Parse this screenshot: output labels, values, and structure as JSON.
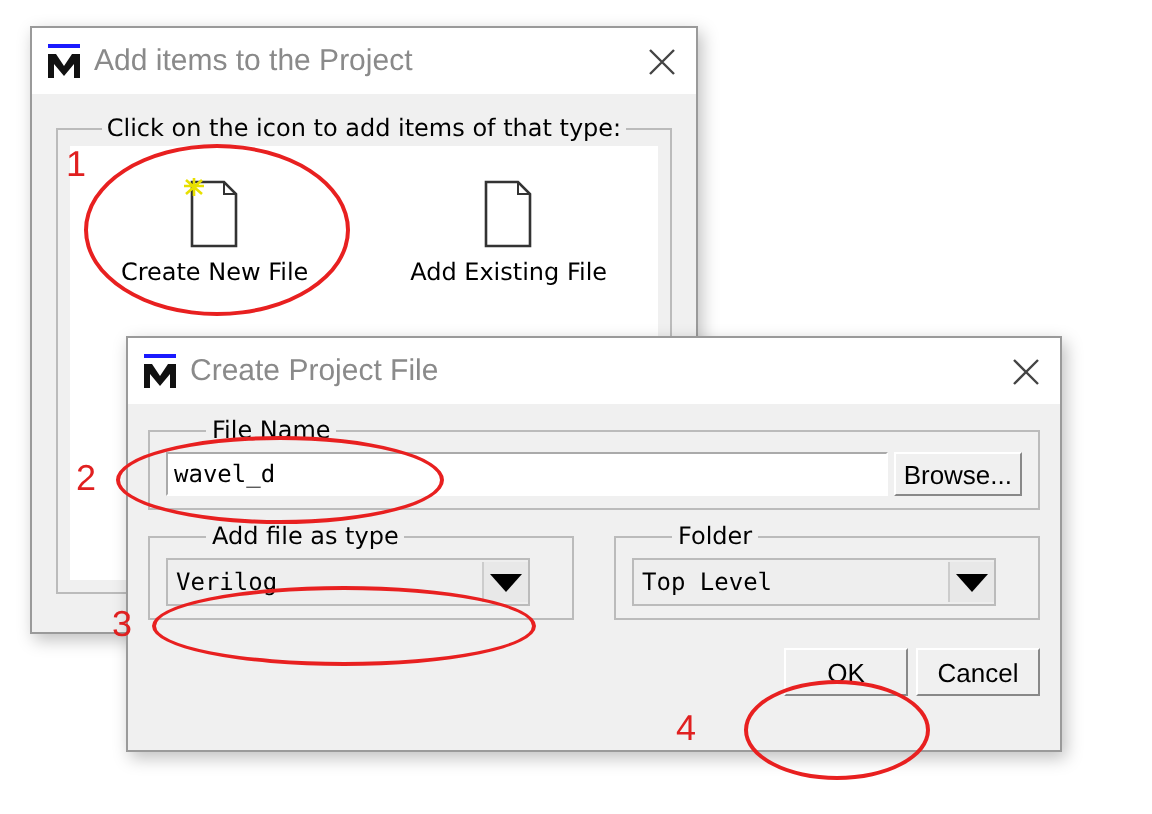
{
  "back_dialog": {
    "title": "Add items to the Project",
    "group_label": "Click on the icon to add items of that type:",
    "items": [
      {
        "label": "Create New File",
        "kind": "new"
      },
      {
        "label": "Add Existing File",
        "kind": "existing"
      }
    ]
  },
  "front_dialog": {
    "title": "Create Project File",
    "file_name": {
      "label": "File Name",
      "value": "wavel_d",
      "browse": "Browse..."
    },
    "type": {
      "label": "Add file as type",
      "value": "Verilog"
    },
    "folder": {
      "label": "Folder",
      "value": "Top Level"
    },
    "buttons": [
      "OK",
      "Cancel"
    ]
  },
  "annotations": [
    {
      "number": "1"
    },
    {
      "number": "2"
    },
    {
      "number": "3"
    },
    {
      "number": "4"
    }
  ]
}
